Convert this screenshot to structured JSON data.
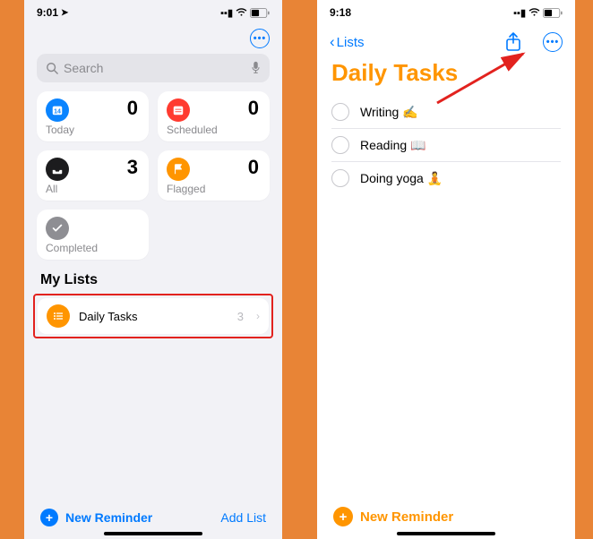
{
  "left": {
    "status": {
      "time": "9:01",
      "loc_icon": "➤"
    },
    "search": {
      "placeholder": "Search"
    },
    "cards": {
      "today": {
        "label": "Today",
        "count": "0"
      },
      "scheduled": {
        "label": "Scheduled",
        "count": "0"
      },
      "all": {
        "label": "All",
        "count": "3"
      },
      "flagged": {
        "label": "Flagged",
        "count": "0"
      },
      "completed": {
        "label": "Completed"
      }
    },
    "mylists_header": "My Lists",
    "list": {
      "name": "Daily Tasks",
      "count": "3"
    },
    "bottom": {
      "new_reminder": "New Reminder",
      "add_list": "Add List"
    }
  },
  "right": {
    "status": {
      "time": "9:18"
    },
    "back_label": "Lists",
    "title": "Daily Tasks",
    "tasks": [
      {
        "text": "Writing ✍️"
      },
      {
        "text": "Reading 📖"
      },
      {
        "text": "Doing yoga 🧘"
      }
    ],
    "bottom": {
      "new_reminder": "New Reminder"
    }
  },
  "colors": {
    "accent_blue": "#007AFF",
    "accent_orange": "#FF9500",
    "highlight_red": "#E2221E"
  }
}
